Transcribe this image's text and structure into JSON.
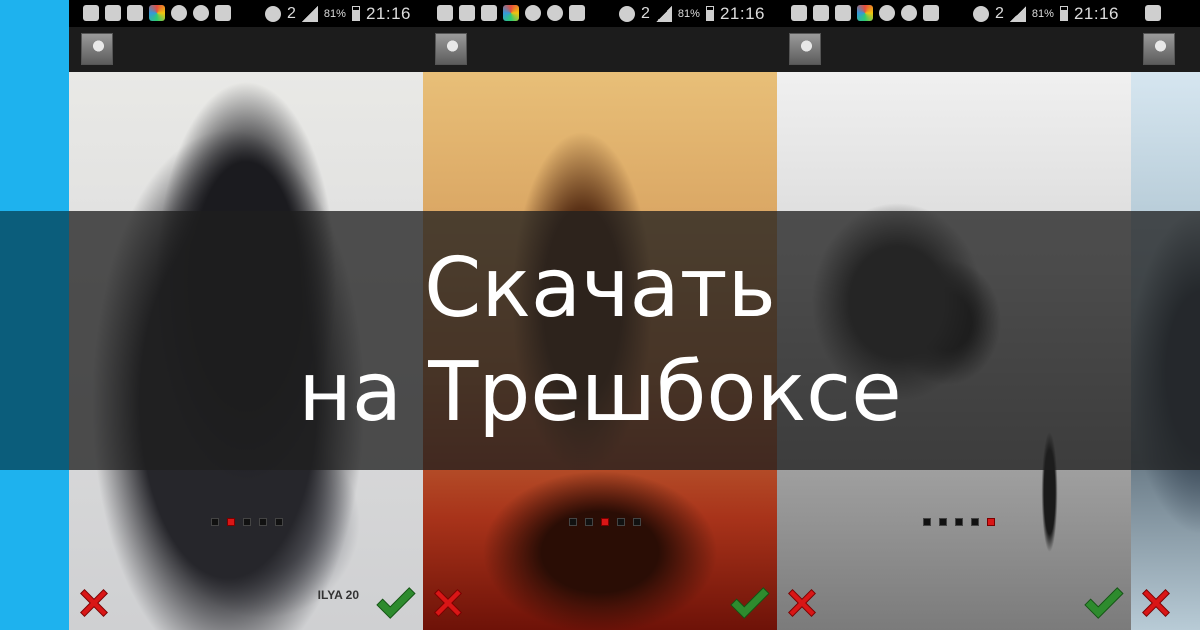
{
  "status_bar": {
    "battery": "81%",
    "network": "2",
    "time": "21:16"
  },
  "artworks": [
    {
      "id": 1,
      "active_dot": 2,
      "signature": "ILYA 20"
    },
    {
      "id": 2,
      "active_dot": 3,
      "signature": ""
    },
    {
      "id": 3,
      "active_dot": 5,
      "signature": ""
    },
    {
      "id": 4,
      "active_dot": 0,
      "signature": ""
    }
  ],
  "banner": {
    "line1": "Скачать",
    "line2": "на Трешбоксе"
  },
  "colors": {
    "background": "#1eb2ee",
    "banner_overlay": "rgba(30,30,30,0.76)",
    "accent_red": "#d91616",
    "accent_green": "#2e8b2e"
  },
  "icons": {
    "reject": "red-x-icon",
    "accept": "green-check-icon"
  }
}
